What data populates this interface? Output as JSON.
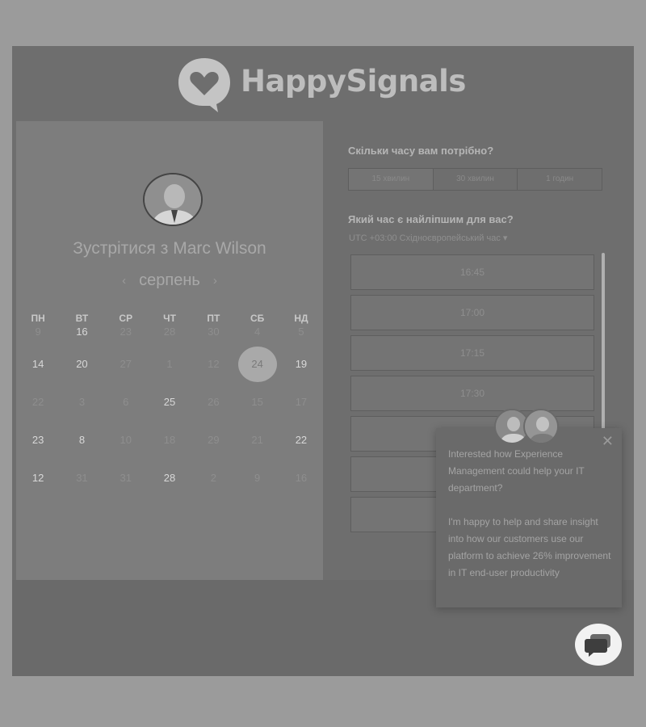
{
  "brand": {
    "name": "HappySignals",
    "logo_icon": "heart-speech-bubble-icon"
  },
  "booking": {
    "title": "Зустрітися з Marc Wilson",
    "month": "серпень",
    "weekdays": [
      "ПН",
      "ВТ",
      "СР",
      "ЧТ",
      "ПТ",
      "СБ",
      "НД"
    ],
    "weeks": [
      [
        {
          "d": "9",
          "avail": false
        },
        {
          "d": "16",
          "avail": true
        },
        {
          "d": "23",
          "avail": false
        },
        {
          "d": "28",
          "avail": false
        },
        {
          "d": "30",
          "avail": false
        },
        {
          "d": "4",
          "avail": false
        },
        {
          "d": "5",
          "avail": false
        }
      ],
      [
        {
          "d": "14",
          "avail": true
        },
        {
          "d": "20",
          "avail": true
        },
        {
          "d": "27",
          "avail": false
        },
        {
          "d": "1",
          "avail": false
        },
        {
          "d": "12",
          "avail": false
        },
        {
          "d": "24",
          "avail": true,
          "selected": true
        },
        {
          "d": "19",
          "avail": true
        }
      ],
      [
        {
          "d": "22",
          "avail": false
        },
        {
          "d": "3",
          "avail": false
        },
        {
          "d": "6",
          "avail": false
        },
        {
          "d": "25",
          "avail": true
        },
        {
          "d": "26",
          "avail": false
        },
        {
          "d": "15",
          "avail": false
        },
        {
          "d": "17",
          "avail": false
        }
      ],
      [
        {
          "d": "23",
          "avail": true
        },
        {
          "d": "8",
          "avail": true
        },
        {
          "d": "10",
          "avail": false
        },
        {
          "d": "18",
          "avail": false
        },
        {
          "d": "29",
          "avail": false
        },
        {
          "d": "21",
          "avail": false
        },
        {
          "d": "22",
          "avail": true
        }
      ],
      [
        {
          "d": "12",
          "avail": true
        },
        {
          "d": "31",
          "avail": false
        },
        {
          "d": "31",
          "avail": false
        },
        {
          "d": "28",
          "avail": true
        },
        {
          "d": "2",
          "avail": false
        },
        {
          "d": "9",
          "avail": false
        },
        {
          "d": "16",
          "avail": false
        }
      ]
    ]
  },
  "duration": {
    "question": "Скільки часу вам потрібно?",
    "options": [
      "15 хвилин",
      "30 хвилин",
      "1 годин"
    ],
    "selected": 0
  },
  "time": {
    "question": "Який час є найліпшим для вас?",
    "timezone": "UTC +03:00 Східноєвропейський час ▾",
    "slots": [
      "16:45",
      "17:00",
      "17:15",
      "17:30",
      "",
      "",
      ""
    ]
  },
  "popup": {
    "text": "Interested how Experience Management could help your IT department?\n\nI'm happy to help and share insight into how our customers use our platform to achieve 26% improvement in IT end-user productivity",
    "close_icon": "close-icon"
  },
  "chat": {
    "icon": "chat-bubble-icon"
  }
}
